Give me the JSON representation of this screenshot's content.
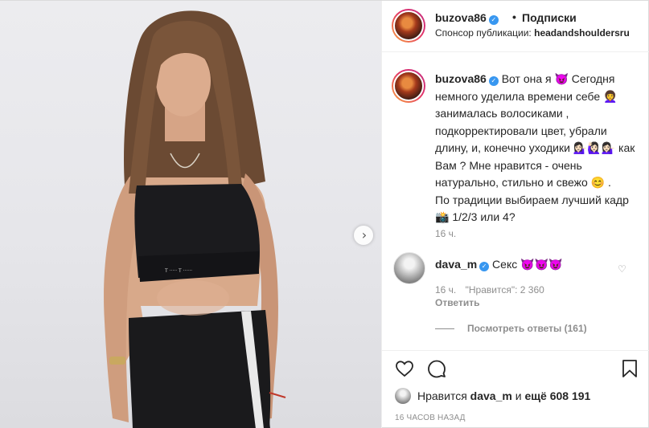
{
  "header": {
    "username": "buzova86",
    "separator": "•",
    "follow_label": "Подписки",
    "sponsor_prefix": "Спонсор публикации:",
    "sponsor_name": "headandshouldersru"
  },
  "caption": {
    "username": "buzova86",
    "text": "Вот она я 😈 Сегодня немного уделила времени себе 👩‍🦱 занималась волосиками , подкорректировали цвет, убрали длину, и, конечно уходики 💁🏻‍♀️🙋🏻‍♀️💁🏻‍♀️ как Вам ? Мне нравится - очень натурально, стильно и свежо 😊 .",
    "text2": "По традиции выбираем лучший кадр 📸 1/2/3 или 4?",
    "time": "16 ч."
  },
  "comment": {
    "username": "dava_m",
    "text": "Секс 😈😈😈",
    "time": "16 ч.",
    "likes": "\"Нравится\": 2 360",
    "reply": "Ответить",
    "view_replies": "Посмотреть ответы (161)"
  },
  "likes": {
    "prefix": "Нравится",
    "user": "dava_m",
    "middle": "и",
    "rest": "ещё 608 191"
  },
  "post_time": "16 ЧАСОВ НАЗАД",
  "colors": {
    "verified": "#3897f0",
    "muted": "#8e8e8e",
    "text": "#262626"
  },
  "icons": [
    "heart-icon",
    "comment-icon",
    "bookmark-icon",
    "chevron-right-icon",
    "verified-badge-icon"
  ]
}
